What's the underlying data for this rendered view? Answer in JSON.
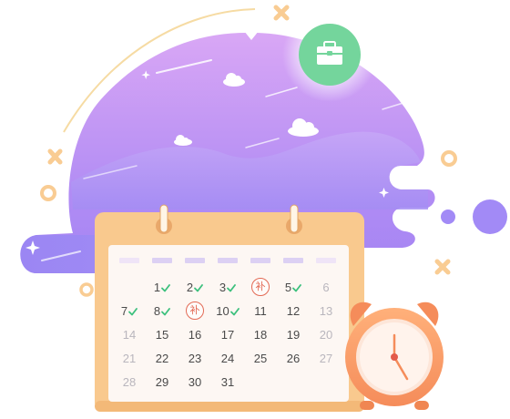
{
  "colors": {
    "accent_purple": "#a88bf5",
    "calendar_frame": "#f9c98e",
    "check_green": "#3cc07d",
    "badge_red": "#e36a55",
    "clock_orange": "#f7935d",
    "badge_green": "#6fd49a"
  },
  "icons": {
    "briefcase": "briefcase-icon",
    "cloud": "cloud-icon",
    "sparkle": "sparkle-icon",
    "alarm_clock": "alarm-clock-icon"
  },
  "calendar": {
    "weekday_headers_count": 7,
    "rows": [
      [
        {
          "text": "",
          "checked": false,
          "muted": false
        },
        {
          "text": "1",
          "checked": true,
          "muted": false
        },
        {
          "text": "2",
          "checked": true,
          "muted": false
        },
        {
          "text": "3",
          "checked": true,
          "muted": false
        },
        {
          "text": "补",
          "badge": true
        },
        {
          "text": "5",
          "checked": true,
          "muted": false
        },
        {
          "text": "6",
          "checked": false,
          "muted": true
        }
      ],
      [
        {
          "text": "7",
          "checked": true,
          "muted": false
        },
        {
          "text": "8",
          "checked": true,
          "muted": false
        },
        {
          "text": "补",
          "badge": true
        },
        {
          "text": "10",
          "checked": true,
          "muted": false
        },
        {
          "text": "11",
          "checked": false,
          "muted": false
        },
        {
          "text": "12",
          "checked": false,
          "muted": false
        },
        {
          "text": "13",
          "checked": false,
          "muted": true
        }
      ],
      [
        {
          "text": "14",
          "checked": false,
          "muted": true
        },
        {
          "text": "15",
          "checked": false,
          "muted": false
        },
        {
          "text": "16",
          "checked": false,
          "muted": false
        },
        {
          "text": "17",
          "checked": false,
          "muted": false
        },
        {
          "text": "18",
          "checked": false,
          "muted": false
        },
        {
          "text": "19",
          "checked": false,
          "muted": false
        },
        {
          "text": "20",
          "checked": false,
          "muted": true
        }
      ],
      [
        {
          "text": "21",
          "checked": false,
          "muted": true
        },
        {
          "text": "22",
          "checked": false,
          "muted": false
        },
        {
          "text": "23",
          "checked": false,
          "muted": false
        },
        {
          "text": "24",
          "checked": false,
          "muted": false
        },
        {
          "text": "25",
          "checked": false,
          "muted": false
        },
        {
          "text": "26",
          "checked": false,
          "muted": false
        },
        {
          "text": "27",
          "checked": false,
          "muted": true
        }
      ],
      [
        {
          "text": "28",
          "checked": false,
          "muted": true
        },
        {
          "text": "29",
          "checked": false,
          "muted": false
        },
        {
          "text": "30",
          "checked": false,
          "muted": false
        },
        {
          "text": "31",
          "checked": false,
          "muted": false
        },
        {
          "text": "",
          "checked": false,
          "muted": false
        },
        {
          "text": "",
          "checked": false,
          "muted": false
        },
        {
          "text": "",
          "checked": false,
          "muted": false
        }
      ]
    ]
  }
}
